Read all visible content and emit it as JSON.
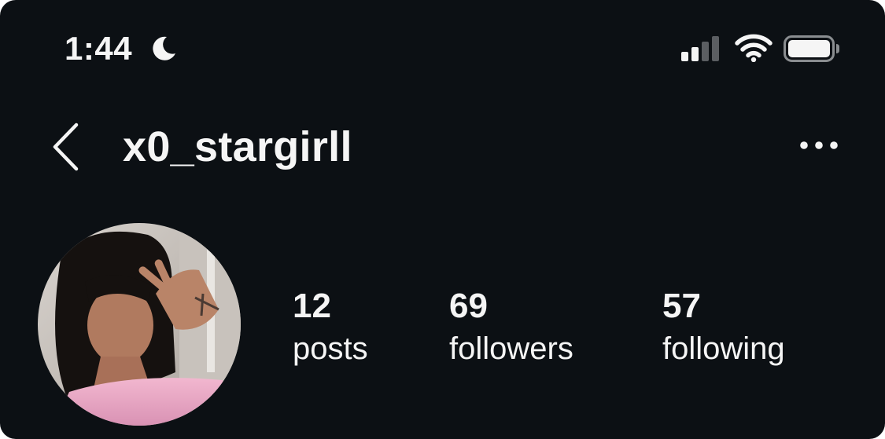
{
  "status_bar": {
    "time": "1:44",
    "focus_icon": "moon-icon",
    "signal_icon": "cellular-signal-icon",
    "wifi_icon": "wifi-icon",
    "battery_icon": "battery-icon"
  },
  "header": {
    "back_icon": "chevron-left-icon",
    "username": "x0_stargirll",
    "more_icon": "more-horizontal-icon"
  },
  "profile": {
    "avatar": "profile-photo",
    "stats": {
      "posts": {
        "count": "12",
        "label": "posts"
      },
      "followers": {
        "count": "69",
        "label": "followers"
      },
      "following": {
        "count": "57",
        "label": "following"
      }
    }
  },
  "colors": {
    "background": "#0c1014",
    "text": "#f5f5f5"
  }
}
